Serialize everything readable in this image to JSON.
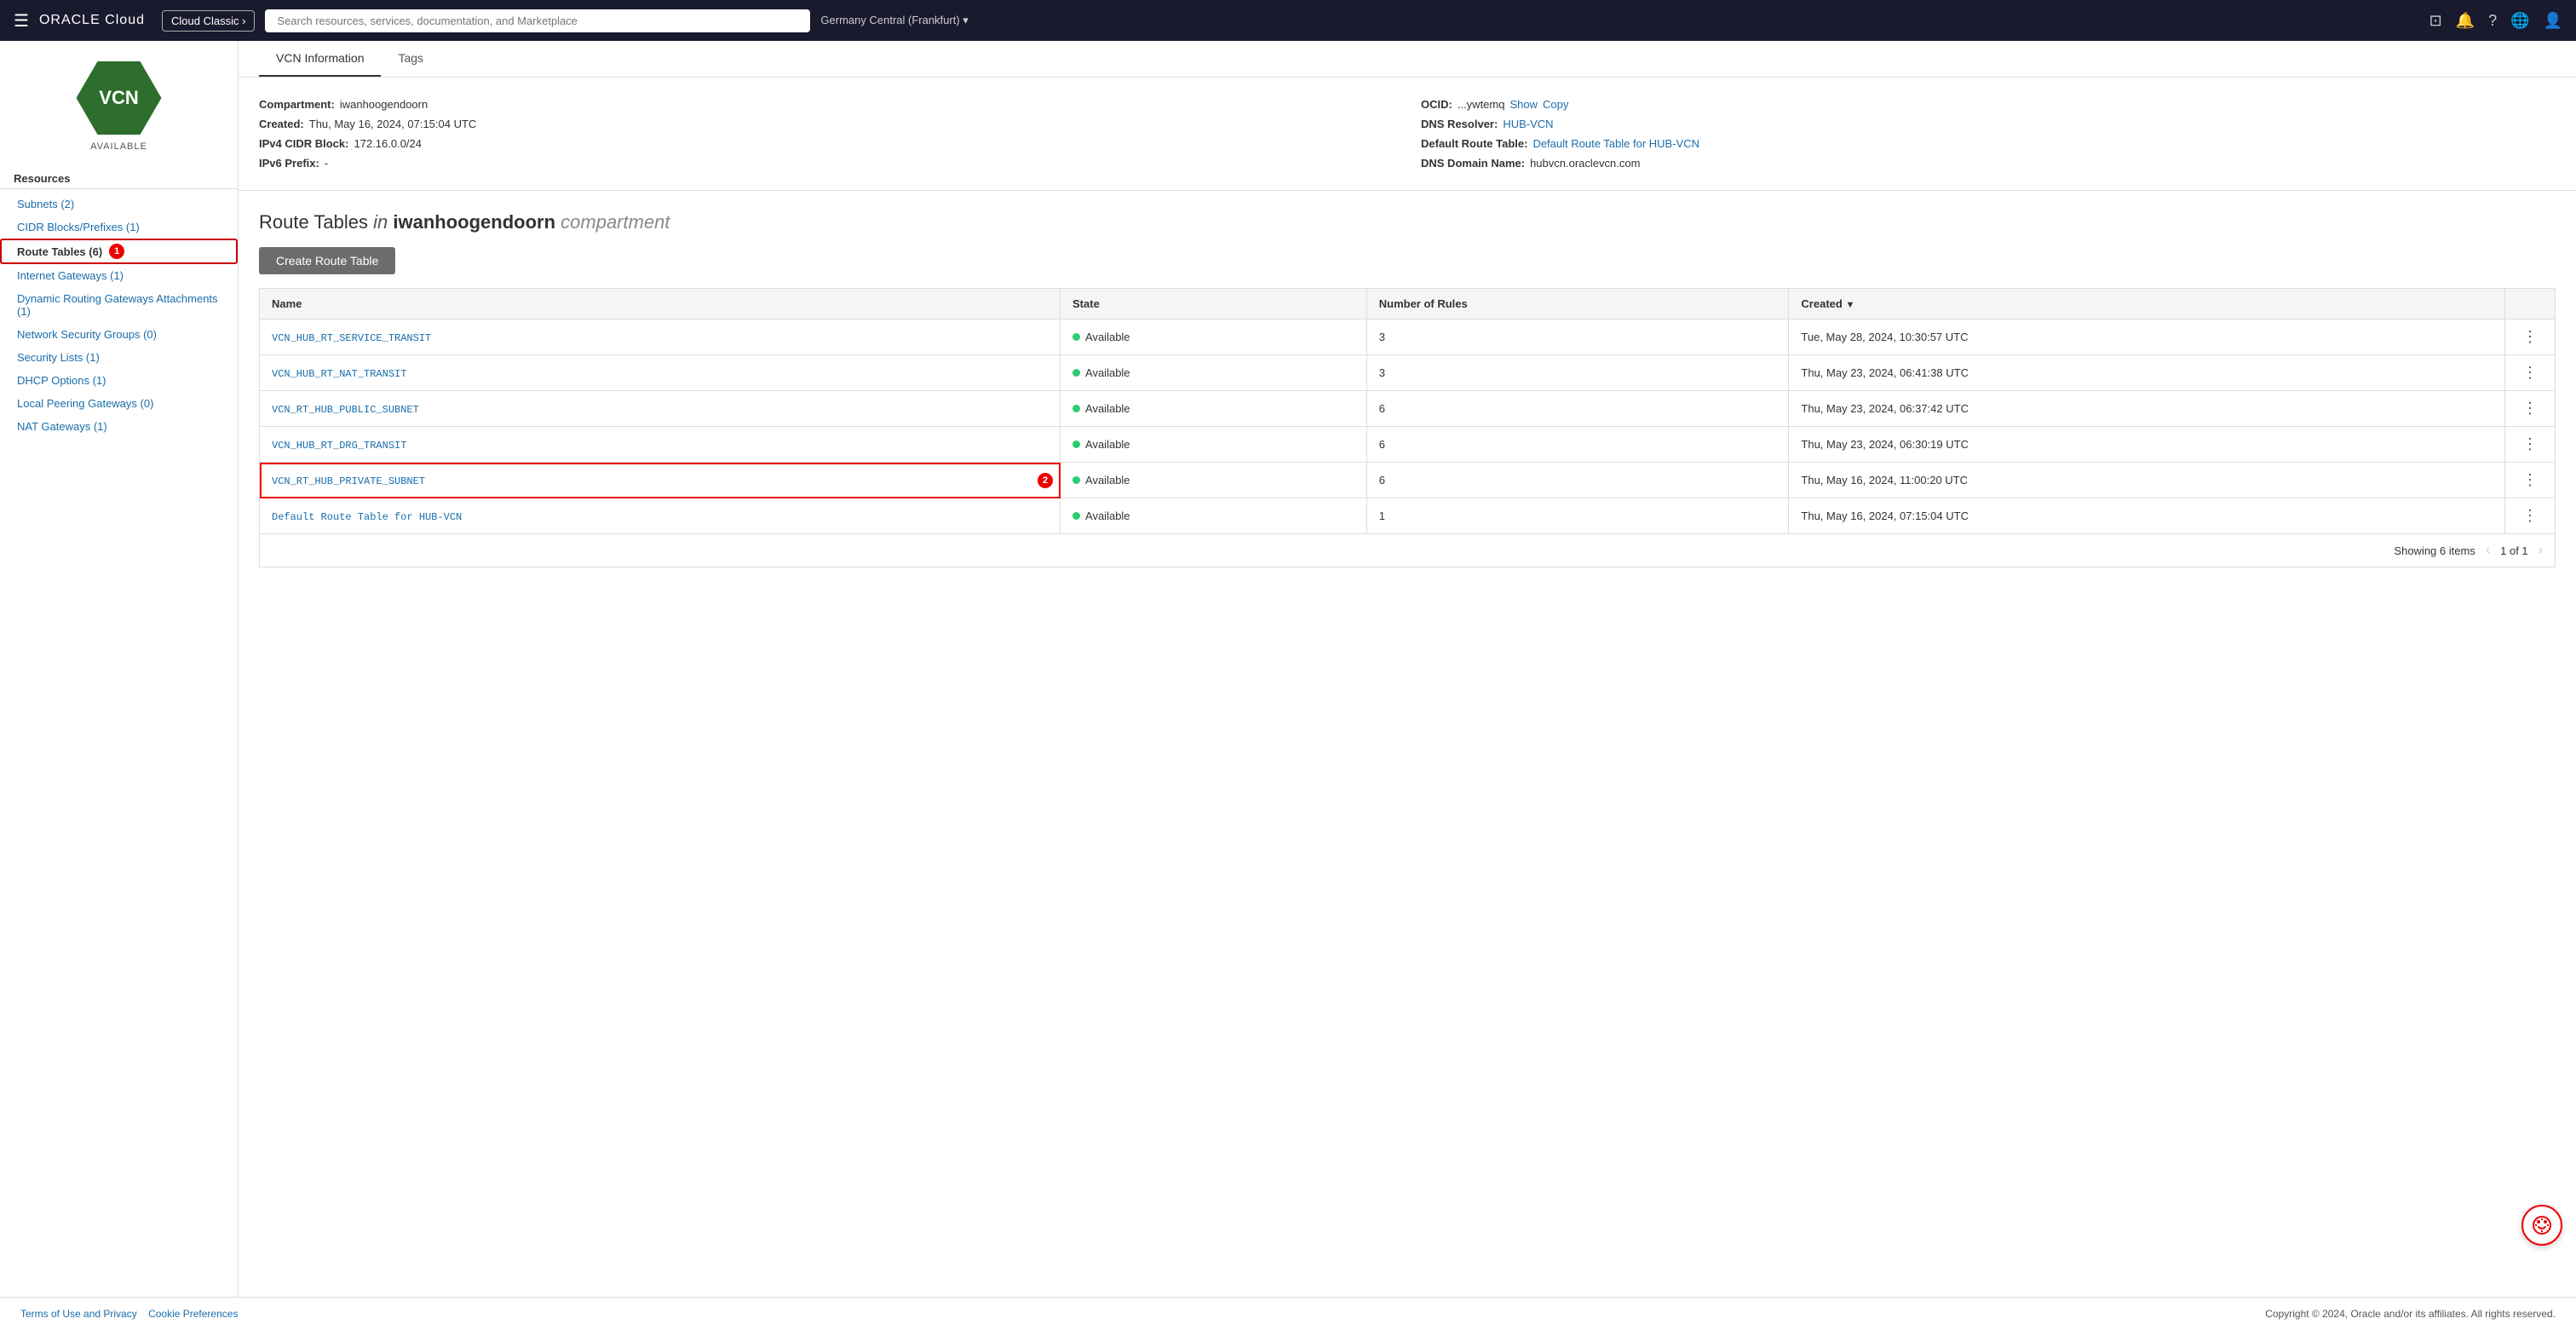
{
  "topnav": {
    "hamburger": "☰",
    "oracle_logo": "ORACLE",
    "oracle_logo_cloud": " Cloud",
    "cloud_classic_btn": "Cloud Classic ›",
    "search_placeholder": "Search resources, services, documentation, and Marketplace",
    "region": "Germany Central (Frankfurt)",
    "region_chevron": "▾"
  },
  "sidebar": {
    "vcn_text": "VCN",
    "vcn_status": "AVAILABLE",
    "section_title": "Resources",
    "links": [
      {
        "label": "Subnets (2)",
        "active": false,
        "id": "subnets"
      },
      {
        "label": "CIDR Blocks/Prefixes (1)",
        "active": false,
        "id": "cidr"
      },
      {
        "label": "Route Tables (6)",
        "active": true,
        "badge": "1",
        "id": "route-tables"
      },
      {
        "label": "Internet Gateways (1)",
        "active": false,
        "id": "internet-gateways"
      },
      {
        "label": "Dynamic Routing Gateways Attachments (1)",
        "active": false,
        "id": "drg"
      },
      {
        "label": "Network Security Groups (0)",
        "active": false,
        "id": "nsg"
      },
      {
        "label": "Security Lists (1)",
        "active": false,
        "id": "security-lists"
      },
      {
        "label": "DHCP Options (1)",
        "active": false,
        "id": "dhcp"
      },
      {
        "label": "Local Peering Gateways (0)",
        "active": false,
        "id": "lpg"
      },
      {
        "label": "NAT Gateways (1)",
        "active": false,
        "id": "nat"
      }
    ]
  },
  "tabs": [
    {
      "label": "VCN Information",
      "active": true
    },
    {
      "label": "Tags",
      "active": false
    }
  ],
  "vcn_info": {
    "left": [
      {
        "label": "Compartment:",
        "value": "iwanhoogendoorn",
        "link": false
      },
      {
        "label": "Created:",
        "value": "Thu, May 16, 2024, 07:15:04 UTC",
        "link": false
      },
      {
        "label": "IPv4 CIDR Block:",
        "value": "172.16.0.0/24",
        "link": false
      },
      {
        "label": "IPv6 Prefix:",
        "value": "-",
        "link": false
      }
    ],
    "right": [
      {
        "label": "OCID:",
        "value": "...ywtemq",
        "link": false,
        "actions": [
          "Show",
          "Copy"
        ]
      },
      {
        "label": "DNS Resolver:",
        "value": "HUB-VCN",
        "link": true
      },
      {
        "label": "Default Route Table:",
        "value": "Default Route Table for HUB-VCN",
        "link": true
      },
      {
        "label": "DNS Domain Name:",
        "value": "hubvcn.oraclevcn.com",
        "link": false
      }
    ]
  },
  "route_tables": {
    "title_prefix": "Route Tables",
    "title_italic": " in ",
    "title_compartment": "iwanhoogendoorn",
    "title_suffix": " compartment",
    "create_btn": "Create Route Table",
    "columns": [
      "Name",
      "State",
      "Number of Rules",
      "Created"
    ],
    "rows": [
      {
        "name": "VCN_HUB_RT_SERVICE_TRANSIT",
        "state": "Available",
        "rules": "3",
        "created": "Tue, May 28, 2024, 10:30:57 UTC",
        "highlighted": false
      },
      {
        "name": "VCN_HUB_RT_NAT_TRANSIT",
        "state": "Available",
        "rules": "3",
        "created": "Thu, May 23, 2024, 06:41:38 UTC",
        "highlighted": false
      },
      {
        "name": "VCN_RT_HUB_PUBLIC_SUBNET",
        "state": "Available",
        "rules": "6",
        "created": "Thu, May 23, 2024, 06:37:42 UTC",
        "highlighted": false
      },
      {
        "name": "VCN_HUB_RT_DRG_TRANSIT",
        "state": "Available",
        "rules": "6",
        "created": "Thu, May 23, 2024, 06:30:19 UTC",
        "highlighted": false
      },
      {
        "name": "VCN_RT_HUB_PRIVATE_SUBNET",
        "state": "Available",
        "rules": "6",
        "created": "Thu, May 16, 2024, 11:00:20 UTC",
        "highlighted": true,
        "badge": "2"
      },
      {
        "name": "Default Route Table for HUB-VCN",
        "state": "Available",
        "rules": "1",
        "created": "Thu, May 16, 2024, 07:15:04 UTC",
        "highlighted": false
      }
    ],
    "pagination": {
      "showing": "Showing 6 items",
      "page_info": "1 of 1"
    }
  },
  "footer": {
    "terms": "Terms of Use and Privacy",
    "cookie": "Cookie Preferences",
    "copyright": "Copyright © 2024, Oracle and/or its affiliates. All rights reserved."
  }
}
